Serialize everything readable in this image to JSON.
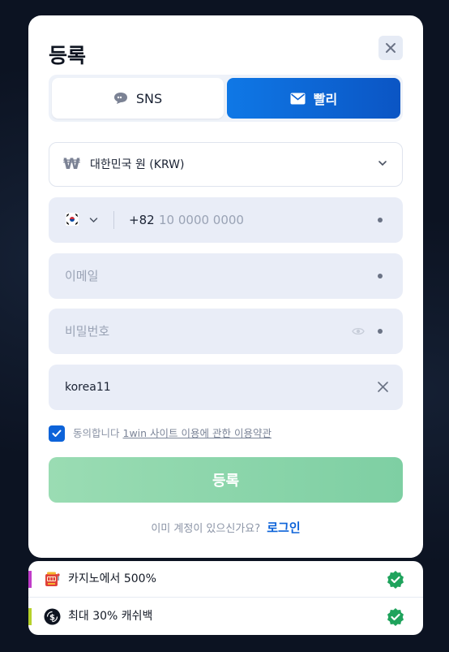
{
  "modal": {
    "title": "등록"
  },
  "tabs": [
    {
      "label": "SNS",
      "icon": "chat-bubble-icon",
      "active": false
    },
    {
      "label": "빨리",
      "icon": "envelope-icon",
      "active": true
    }
  ],
  "currency": {
    "symbol": "₩",
    "label": "대한민국 원 (KRW)"
  },
  "phone": {
    "dial_code": "+82",
    "placeholder": "10 0000 0000",
    "flag": "south-korea-flag-icon"
  },
  "email": {
    "placeholder": "이메일"
  },
  "password": {
    "placeholder": "비밀번호"
  },
  "promo": {
    "value": "korea11"
  },
  "agreement": {
    "checked": true,
    "prefix": "동의합니다",
    "link_text": "1win 사이트 이용에 관한 이용약관"
  },
  "submit_label": "등록",
  "login_prompt": {
    "text": "이미 계정이 있으신가요?",
    "link": "로그인"
  },
  "bonuses": [
    {
      "text": "카지노에서 500%",
      "icon": "slot-machine-icon",
      "accent": "#c03cc9"
    },
    {
      "text": "최대 30% 캐쉬백",
      "icon": "cashback-coin-icon",
      "accent": "#b6d12a"
    }
  ],
  "colors": {
    "primary": "#0d63d9",
    "submit_disabled": "#8fd6ad",
    "verified": "#1fa35c"
  }
}
